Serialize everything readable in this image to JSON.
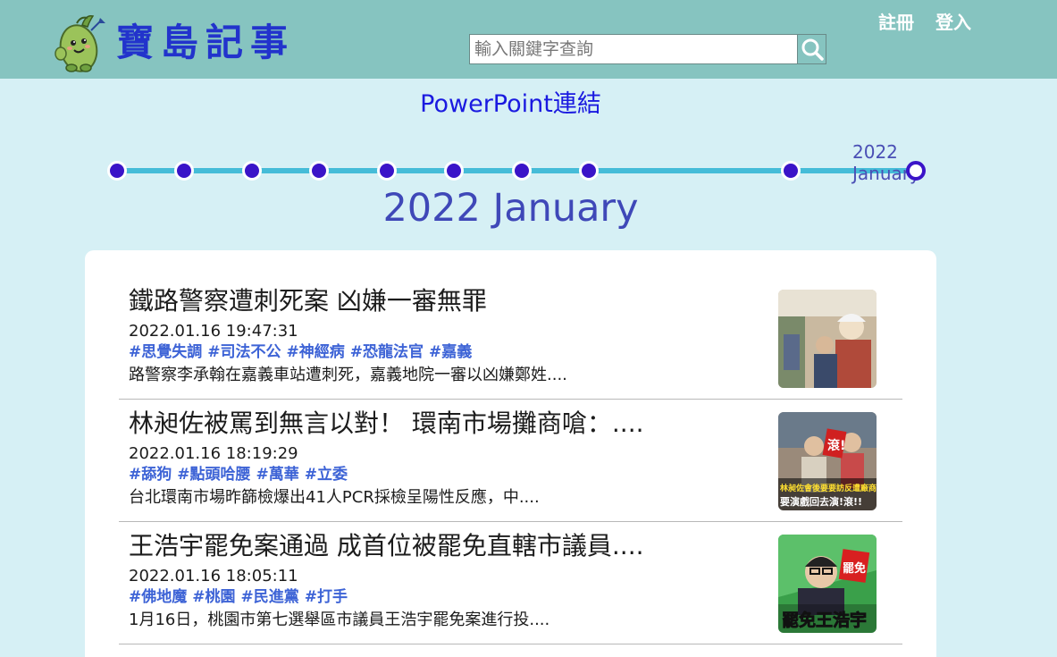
{
  "header": {
    "brand": "寶島記事",
    "search_placeholder": "輸入關鍵字查詢",
    "register": "註冊",
    "login": "登入"
  },
  "ppt_link": "PowerPoint連結",
  "timeline": {
    "active_label": "2022 January",
    "heading": "2022 January",
    "dot_count": 10,
    "active_index": 9
  },
  "articles": [
    {
      "title": "鐵路警察遭刺死案 凶嫌一審無罪",
      "date": "2022.01.16 19:47:31",
      "tags": [
        "#思覺失調",
        "#司法不公",
        "#神經病",
        "#恐龍法官",
        "#嘉義"
      ],
      "excerpt": "路警察李承翰在嘉義車站遭刺死，嘉義地院一審以凶嫌鄭姓...."
    },
    {
      "title": "林昶佐被罵到無言以對！ 環南市場攤商嗆：....",
      "date": "2022.01.16 18:19:29",
      "tags": [
        "#舔狗",
        "#點頭哈腰",
        "#萬華",
        "#立委"
      ],
      "excerpt": "台北環南市場昨篩檢爆出41人PCR採檢呈陽性反應，中....",
      "thumb_caption_1": "林昶佐會後要要訪反遭廠商嗆:",
      "thumb_caption_2": "要演戲回去演!滾!!",
      "thumb_stamp": "滾!"
    },
    {
      "title": "王浩宇罷免案通過 成首位被罷免直轄市議員....",
      "date": "2022.01.16 18:05:11",
      "tags": [
        "#佛地魔",
        "#桃園",
        "#民進黨",
        "#打手"
      ],
      "excerpt": "1月16日，桃園市第七選舉區市議員王浩宇罷免案進行投....",
      "thumb_caption": "罷免王浩宇",
      "thumb_stamp": "罷免"
    }
  ],
  "colors": {
    "header_bg": "#86c4c0",
    "page_bg": "#d6f0f5",
    "brand": "#2233cc",
    "link": "#1a1ae0",
    "tag": "#3d63d6",
    "timeline_line": "#45bcd8",
    "timeline_dot": "#3a14c8"
  }
}
